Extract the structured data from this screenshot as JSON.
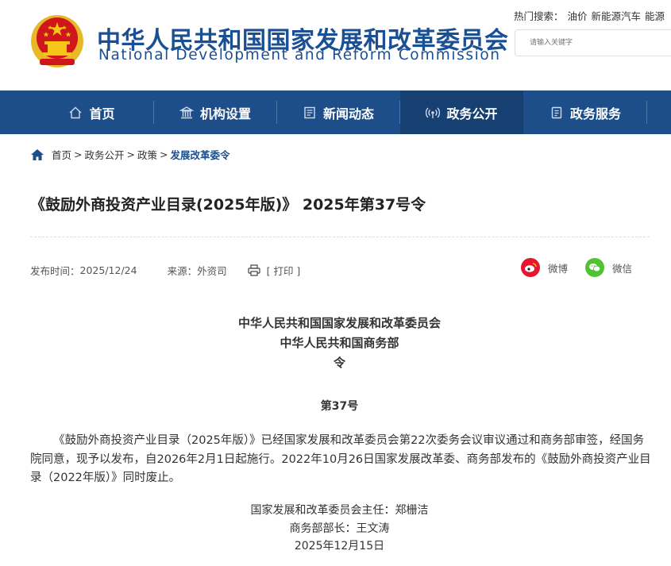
{
  "header": {
    "site_name_cn": "中华人民共和国国家发展和改革委员会",
    "site_name_en": "National Development and Reform Commission",
    "hot_search_label": "热门搜索：",
    "hot_keywords": [
      "油价",
      "新能源汽车",
      "能源"
    ],
    "search_placeholder": "请输入关键字"
  },
  "nav": [
    {
      "label": "首页",
      "icon": "home-icon"
    },
    {
      "label": "机构设置",
      "icon": "institution-icon"
    },
    {
      "label": "新闻动态",
      "icon": "news-icon"
    },
    {
      "label": "政务公开",
      "icon": "broadcast-icon",
      "active": true
    },
    {
      "label": "政务服务",
      "icon": "service-icon"
    }
  ],
  "breadcrumb": [
    "首页",
    "政务公开",
    "政策",
    "发展改革委令"
  ],
  "article": {
    "title": "《鼓励外商投资产业目录(2025年版)》 2025年第37号令",
    "publish_label": "发布时间：",
    "publish_date": "2025/12/24",
    "source_label": "来源：",
    "source": "外资司",
    "print_label": "[ 打印 ]",
    "share": [
      {
        "label": "微博",
        "icon": "weibo-icon",
        "color": "#e6162d"
      },
      {
        "label": "微信",
        "icon": "wechat-icon",
        "color": "#51c332"
      }
    ],
    "issuer_1": "中华人民共和国国家发展和改革委员会",
    "issuer_2": "中华人民共和国商务部",
    "doc_type": "令",
    "doc_number": "第37号",
    "paragraph": "《鼓励外商投资产业目录（2025年版）》已经国家发展和改革委员会第22次委务会议审议通过和商务部审签，经国务院同意，现予以发布，自2026年2月1日起施行。2022年10月26日国家发展改革委、商务部发布的《鼓励外商投资产业目录（2022年版）》同时废止。",
    "signature_1": "国家发展和改革委员会主任：郑栅洁",
    "signature_2": "商务部部长：王文涛",
    "signature_date": "2025年12月15日"
  },
  "colors": {
    "brand": "#1d4e89",
    "nav_active": "#163f72",
    "emblem_red": "#d1161b",
    "emblem_gold": "#f5c518"
  }
}
